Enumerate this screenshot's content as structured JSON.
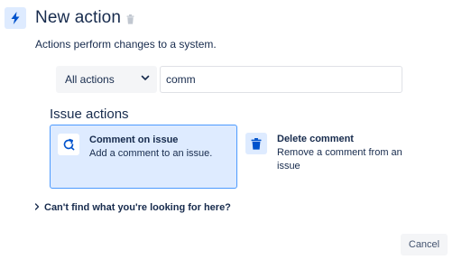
{
  "header": {
    "title": "New action",
    "icon": "lightning-icon",
    "delete_icon": "trash-icon"
  },
  "subtitle": "Actions perform changes to a system.",
  "filter": {
    "selected": "All actions",
    "icon": "chevron-down-icon"
  },
  "search": {
    "value": "comm"
  },
  "section": {
    "title": "Issue actions"
  },
  "actions": [
    {
      "title": "Comment on issue",
      "description": "Add a comment to an issue.",
      "icon": "comment-refresh-icon",
      "selected": true
    },
    {
      "title": "Delete comment",
      "description": "Remove a comment from an issue",
      "icon": "trash-icon",
      "selected": false
    }
  ],
  "help": {
    "label": "Can't find what you're looking for here?",
    "icon": "chevron-right-icon"
  },
  "footer": {
    "cancel_label": "Cancel"
  },
  "colors": {
    "primary": "#0052cc",
    "selected_bg": "#deebff",
    "selected_border": "#4c9aff",
    "text": "#172b4d"
  }
}
